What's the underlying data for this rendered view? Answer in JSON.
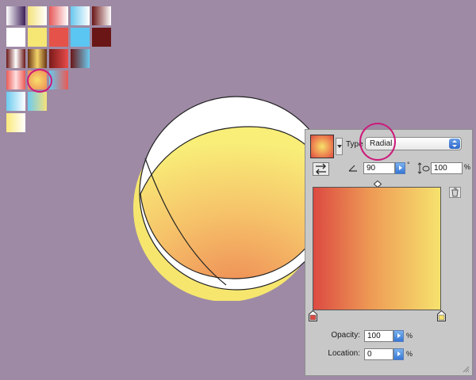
{
  "swatch_library": {
    "columns": 5,
    "rows": [
      [
        {
          "name": "White, Purple",
          "colors": [
            "#ffffff",
            "#3d1f58"
          ]
        },
        {
          "name": "Yellow, White",
          "colors": [
            "#f5e27a",
            "#ffffff"
          ]
        },
        {
          "name": "Red, White",
          "colors": [
            "#e85a5a",
            "#ffffff"
          ]
        },
        {
          "name": "Blue, White",
          "colors": [
            "#68c8ee",
            "#ffffff"
          ]
        },
        {
          "name": "Dark Red, White",
          "colors": [
            "#6b1515",
            "#ffffff"
          ]
        }
      ],
      [
        {
          "name": "White",
          "colors": [
            "#ffffff",
            "#ffffff"
          ]
        },
        {
          "name": "Yellow",
          "colors": [
            "#f6e673",
            "#f6e673"
          ]
        },
        {
          "name": "Red",
          "colors": [
            "#e4524a",
            "#e4524a"
          ]
        },
        {
          "name": "Blue",
          "colors": [
            "#5cc6f2",
            "#5cc6f2"
          ]
        },
        {
          "name": "Dark Red",
          "colors": [
            "#6a1616",
            "#6a1616"
          ]
        }
      ],
      [
        {
          "name": "Dark Red, White, Dark Red",
          "colors": [
            "#6a1616",
            "#ffffff",
            "#6a1616"
          ]
        },
        {
          "name": "Brown, Yellow, Brown",
          "colors": [
            "#6a3414",
            "#f3d36a",
            "#6a3414"
          ]
        },
        {
          "name": "Dark Red, Red",
          "colors": [
            "#7a1a1a",
            "#e84c4a"
          ]
        },
        {
          "name": "Dark Red, Blue",
          "colors": [
            "#6a1616",
            "#6ccbf0"
          ]
        }
      ],
      [
        {
          "name": "Red, White, Red",
          "colors": [
            "#ea5a55",
            "#ffe0e0",
            "#ea5a55"
          ]
        },
        {
          "name": "Radial Yellow Orange",
          "colors": [
            "#f8e06c",
            "#ee8a55"
          ]
        },
        {
          "name": "Blue, Red",
          "colors": [
            "#68c8ee",
            "#e85a55"
          ]
        }
      ],
      [
        {
          "name": "Blue, White",
          "colors": [
            "#6ccbf0",
            "#ffffff"
          ]
        },
        {
          "name": "Blue, Yellow",
          "colors": [
            "#6ccbf0",
            "#f6e27a"
          ]
        }
      ],
      [
        {
          "name": "Yellow, White",
          "colors": [
            "#fbe97a",
            "#ffffff"
          ]
        }
      ]
    ]
  },
  "gradient_panel": {
    "type_label": "Type",
    "type_value": "Radial",
    "angle_value": "90",
    "angle_unit": "°",
    "aspect_value": "100",
    "aspect_unit": "%",
    "opacity_label": "Opacity:",
    "opacity_value": "100",
    "opacity_unit": "%",
    "location_label": "Location:",
    "location_value": "0",
    "location_unit": "%",
    "stops": [
      {
        "color": "#dc4a42",
        "location": 0
      },
      {
        "color": "#f6e26e",
        "location": 100
      }
    ],
    "midpoint": 50
  },
  "colors": {
    "canvas_bg": "#9e8aa5",
    "highlight_ring": "#cc1a7a",
    "panel_bg": "#c8c8c8",
    "artwork_gold": "#f6e66e"
  }
}
